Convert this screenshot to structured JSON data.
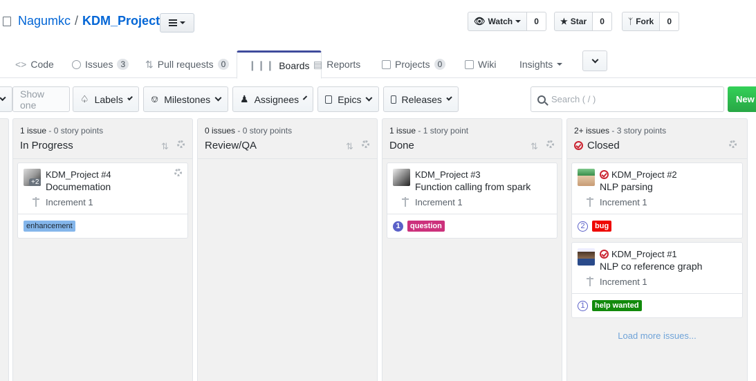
{
  "repo": {
    "owner": "Nagumkc",
    "separator": "/",
    "name": "KDM_Project"
  },
  "social": [
    {
      "label": "Watch",
      "count": "0"
    },
    {
      "label": "Star",
      "count": "0"
    },
    {
      "label": "Fork",
      "count": "0"
    }
  ],
  "tabs": [
    {
      "label": "Code"
    },
    {
      "label": "Issues",
      "count": "3"
    },
    {
      "label": "Pull requests",
      "count": "0"
    },
    {
      "label": "Boards"
    },
    {
      "label": "Reports"
    },
    {
      "label": "Projects",
      "count": "0"
    },
    {
      "label": "Wiki"
    },
    {
      "label": "Insights"
    }
  ],
  "filters": {
    "show_one": "Show one",
    "labels": "Labels",
    "milestones": "Milestones",
    "assignees": "Assignees",
    "epics": "Epics",
    "releases": "Releases",
    "search_placeholder": "Search ( / )",
    "new": "New"
  },
  "columns": [
    {
      "meta_count": "1 issue",
      "meta_points": "- 0 story points",
      "title": "In Progress",
      "cards": [
        {
          "ref": "KDM_Project #4",
          "title": "Documemation",
          "milestone": "Increment 1",
          "extra_assignees": "+2",
          "labels": [
            {
              "text": "enhancement",
              "bg": "#84b6eb",
              "fg": "#1c2733"
            }
          ]
        }
      ]
    },
    {
      "meta_count": "0 issues",
      "meta_points": "- 0 story points",
      "title": "Review/QA",
      "cards": []
    },
    {
      "meta_count": "1 issue",
      "meta_points": "- 1 story point",
      "title": "Done",
      "cards": [
        {
          "ref": "KDM_Project #3",
          "title": "Function calling from spark",
          "milestone": "Increment 1",
          "points": "1",
          "labels": [
            {
              "text": "question",
              "bg": "#cc317c",
              "fg": "#ffffff"
            }
          ]
        }
      ]
    },
    {
      "meta_count": "2+ issues",
      "meta_points": "- 3 story points",
      "title": "Closed",
      "load_more": "Load more issues...",
      "cards": [
        {
          "ref": "KDM_Project #2",
          "title": "NLP parsing",
          "milestone": "Increment 1",
          "points": "2",
          "labels": [
            {
              "text": "bug",
              "bg": "#ee0701",
              "fg": "#ffffff"
            }
          ]
        },
        {
          "ref": "KDM_Project #1",
          "title": "NLP co reference graph",
          "milestone": "Increment 1",
          "points": "1",
          "labels": [
            {
              "text": "help wanted",
              "bg": "#128a0c",
              "fg": "#ffffff"
            }
          ]
        }
      ]
    }
  ]
}
